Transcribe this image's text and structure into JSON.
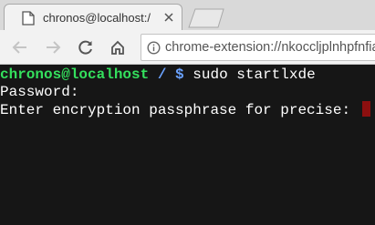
{
  "tab": {
    "title": "chronos@localhost:/"
  },
  "omnibox": {
    "url": "chrome-extension://nkoccljplnhpfnfia"
  },
  "terminal": {
    "prompt_user": "chronos@localhost",
    "prompt_path": " / ",
    "prompt_symbol": "$",
    "command": " sudo startlxde",
    "line2": "Password:",
    "line3": "Enter encryption passphrase for precise: "
  }
}
